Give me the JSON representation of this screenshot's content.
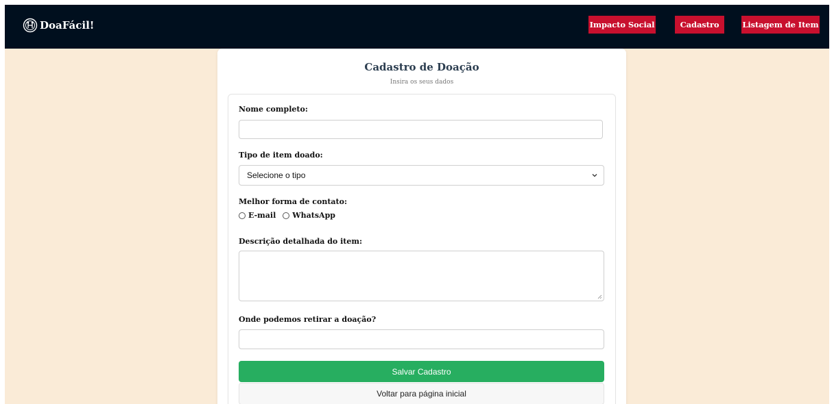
{
  "navbar": {
    "brand": "DoaFácil!",
    "brand_icon": "handshake-globe-logo-icon",
    "links": [
      "Impacto Social",
      "Cadastro",
      "Listagem de Item"
    ]
  },
  "card": {
    "title": "Cadastro de Doação",
    "subtitle": "Insira os seus dados"
  },
  "form": {
    "name_label": "Nome completo:",
    "name_value": "",
    "type_label": "Tipo de item doado:",
    "type_selected": "Selecione o tipo",
    "contact_label": "Melhor forma de contato:",
    "contact_options": [
      "E-mail",
      "WhatsApp"
    ],
    "description_label": "Descrição detalhada do item:",
    "description_value": "",
    "pickup_label": "Onde podemos retirar a doação?",
    "pickup_value": "",
    "save_button": "Salvar Cadastro",
    "back_button": "Voltar para página inicial"
  },
  "colors": {
    "navbar_bg": "#000f1e",
    "page_bg": "#faebd7",
    "nav_button_bg": "#c8102e",
    "save_button_bg": "#27ae60"
  }
}
